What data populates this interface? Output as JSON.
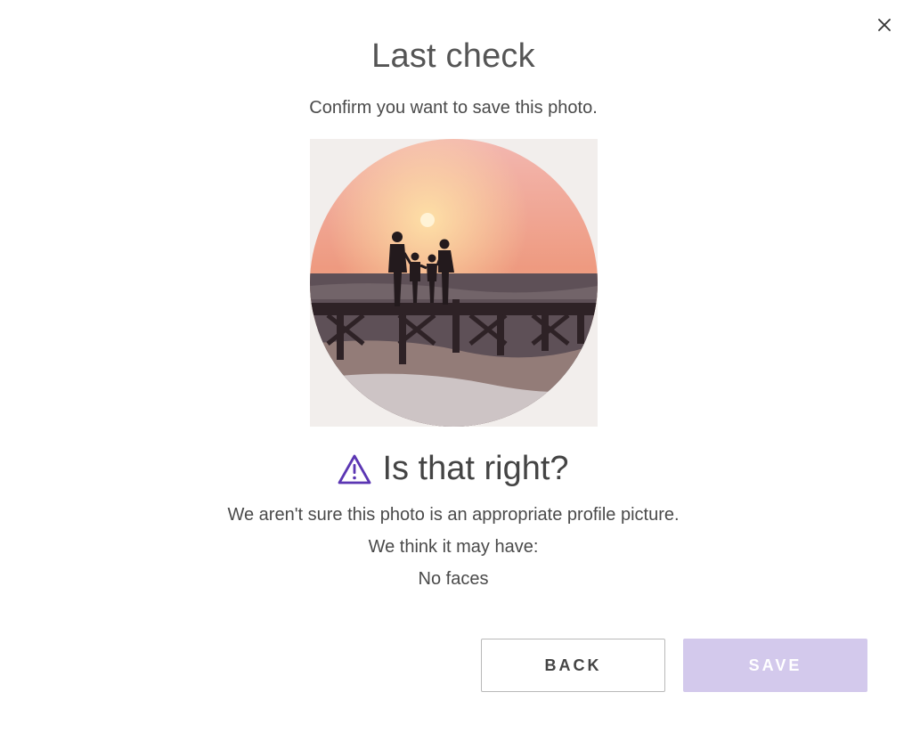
{
  "dialog": {
    "title": "Last check",
    "subtitle": "Confirm you want to save this photo.",
    "close_icon": "close-icon"
  },
  "photo": {
    "subject": "family silhouette on pier at sunset"
  },
  "warning": {
    "icon": "warning-icon",
    "heading": "Is that right?",
    "line1": "We aren't sure this photo is an appropriate profile picture.",
    "line2": "We think it may have:",
    "reason": "No faces"
  },
  "actions": {
    "back_label": "BACK",
    "save_label": "SAVE"
  },
  "colors": {
    "accent": "#5b36b3",
    "save_disabled_bg": "#d3c9ec"
  }
}
